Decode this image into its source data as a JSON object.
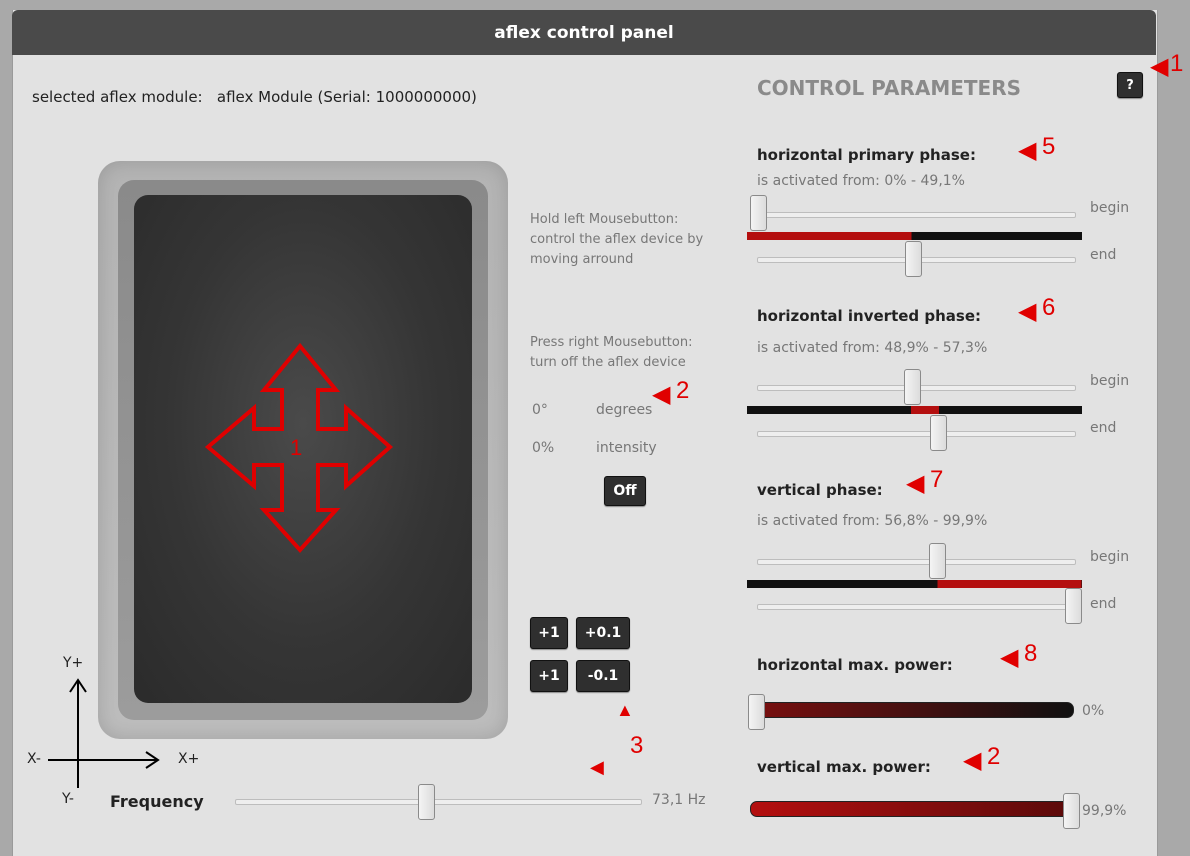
{
  "window": {
    "title": "aflex control panel"
  },
  "module": {
    "label": "selected aflex module:",
    "value": "aflex Module (Serial: 1000000000)"
  },
  "pad": {
    "center_marker": "1"
  },
  "instructions": {
    "left_button": [
      "Hold left Mousebutton:",
      "control the aflex device by",
      "moving arround"
    ],
    "right_button": [
      "Press right Mousebutton:",
      "turn off the aflex device"
    ]
  },
  "readout": {
    "degrees_value": "0°",
    "degrees_label": "degrees",
    "intensity_value": "0%",
    "intensity_label": "intensity"
  },
  "off_button": {
    "label": "Off"
  },
  "step_buttons": {
    "plus1_a": "+1",
    "plus01": "+0.1",
    "plus1_b": "+1",
    "minus01": "-0.1"
  },
  "axes": {
    "y_plus": "Y+",
    "y_minus": "Y-",
    "x_minus": "X-",
    "x_plus": "X+"
  },
  "frequency": {
    "label": "Frequency",
    "value_text": "73,1 Hz",
    "slider_fraction": 0.47
  },
  "control": {
    "title": "CONTROL PARAMETERS",
    "help_label": "?"
  },
  "horizontal_primary": {
    "title": "horizontal primary phase:",
    "range_text": "is activated from: 0%  -  49,1%",
    "begin_label": "begin",
    "end_label": "end",
    "begin": 0.0,
    "end": 0.491
  },
  "horizontal_inverted": {
    "title": "horizontal inverted phase:",
    "range_text": "is activated from: 48,9%  -  57,3%",
    "begin_label": "begin",
    "end_label": "end",
    "begin": 0.489,
    "end": 0.573
  },
  "vertical": {
    "title": "vertical phase:",
    "range_text": "is activated from: 56,8%  -  99,9%",
    "begin_label": "begin",
    "end_label": "end",
    "begin": 0.568,
    "end": 0.999
  },
  "horizontal_power": {
    "title": "horizontal max. power:",
    "value_text": "0%",
    "fraction": 0.0
  },
  "vertical_power": {
    "title": "vertical max. power:",
    "value_text": "99,9%",
    "fraction": 0.999
  },
  "annotations": {
    "a1": "1",
    "a2": "2",
    "a3": "3",
    "a5": "5",
    "a6": "6",
    "a7": "7",
    "a8": "8",
    "a2b": "2"
  },
  "colors": {
    "accent_red": "#b40f0f",
    "annotation_red": "#e00000",
    "title_bar": "#4a4a4a"
  }
}
